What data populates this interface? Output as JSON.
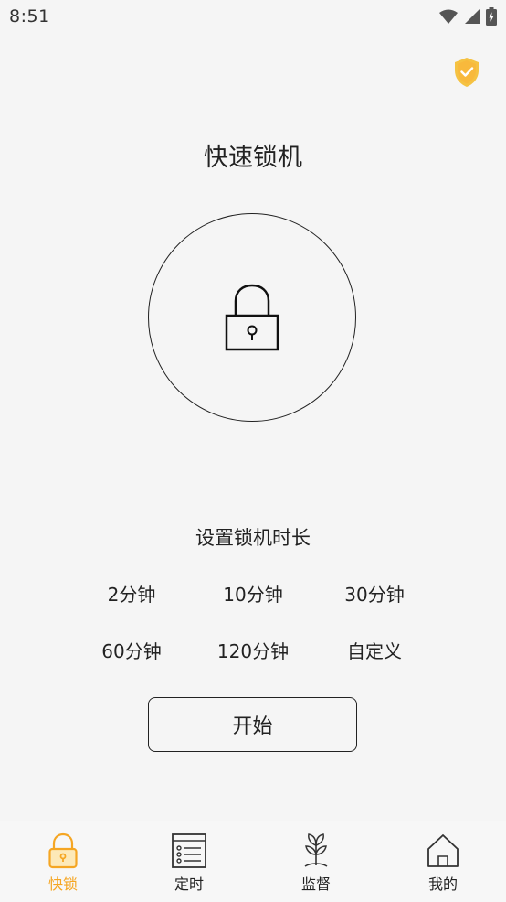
{
  "status_bar": {
    "time": "8:51"
  },
  "page": {
    "title": "快速锁机",
    "subtitle": "设置锁机时长"
  },
  "durations": [
    "2分钟",
    "10分钟",
    "30分钟",
    "60分钟",
    "120分钟",
    "自定义"
  ],
  "start_button": {
    "label": "开始"
  },
  "nav": [
    {
      "label": "快锁",
      "icon": "lock-icon",
      "active": true
    },
    {
      "label": "定时",
      "icon": "list-icon"
    },
    {
      "label": "监督",
      "icon": "plant-icon"
    },
    {
      "label": "我的",
      "icon": "home-icon"
    }
  ],
  "colors": {
    "accent": "#f5a623",
    "background": "#f5f5f5",
    "text": "#222222"
  }
}
